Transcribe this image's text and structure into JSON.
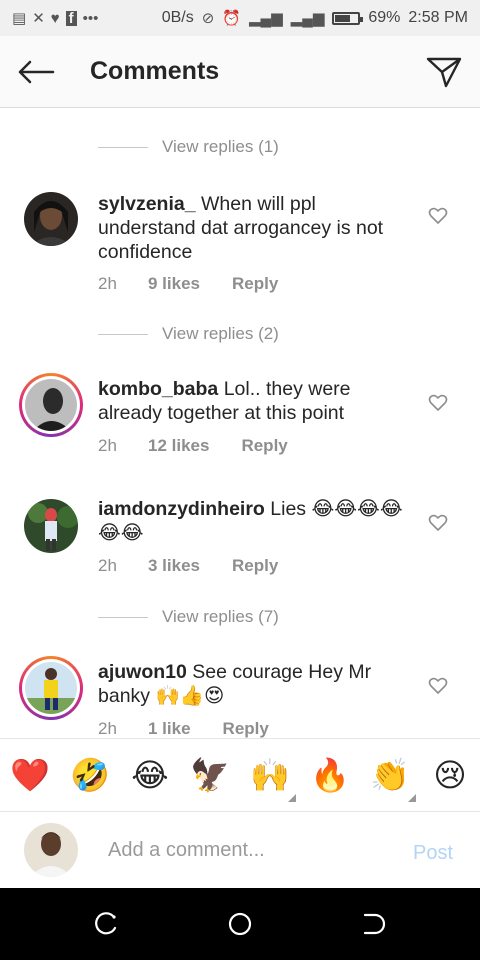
{
  "status_bar": {
    "network_speed": "0B/s",
    "battery_percent": "69%",
    "battery_level": 0.69,
    "time": "2:58 PM"
  },
  "header": {
    "title": "Comments",
    "back_icon": "back-arrow-icon",
    "send_icon": "paper-plane-icon"
  },
  "comments": [
    {
      "view_replies": "View replies (1)"
    },
    {
      "username": "sylvzenia_",
      "text": "When will ppl understand dat  arrogancey is not confidence",
      "time": "2h",
      "likes": "9 likes",
      "reply": "Reply",
      "has_story_ring": false
    },
    {
      "view_replies": "View replies (2)"
    },
    {
      "username": "kombo_baba",
      "text": "Lol.. they were already together at this point",
      "time": "2h",
      "likes": "12 likes",
      "reply": "Reply",
      "has_story_ring": true
    },
    {
      "username": "iamdonzydinheiro",
      "text": "Lies 😂😂😂😂😂😂",
      "time": "2h",
      "likes": "3 likes",
      "reply": "Reply",
      "has_story_ring": false
    },
    {
      "view_replies": "View replies (7)"
    },
    {
      "username": "ajuwon10",
      "text": "See courage Hey Mr banky 🙌👍😍",
      "time": "2h",
      "likes": "1 like",
      "reply": "Reply",
      "has_story_ring": true
    }
  ],
  "emoji_bar": [
    "❤️",
    "🤣",
    "😂",
    "🦅",
    "🙌",
    "🔥",
    "👏",
    "😢"
  ],
  "add_comment": {
    "placeholder": "Add a comment...",
    "post_label": "Post"
  },
  "colors": {
    "accent_disabled": "#b3d4f5",
    "secondary_text": "#8e8e8e",
    "primary_text": "#262626"
  }
}
